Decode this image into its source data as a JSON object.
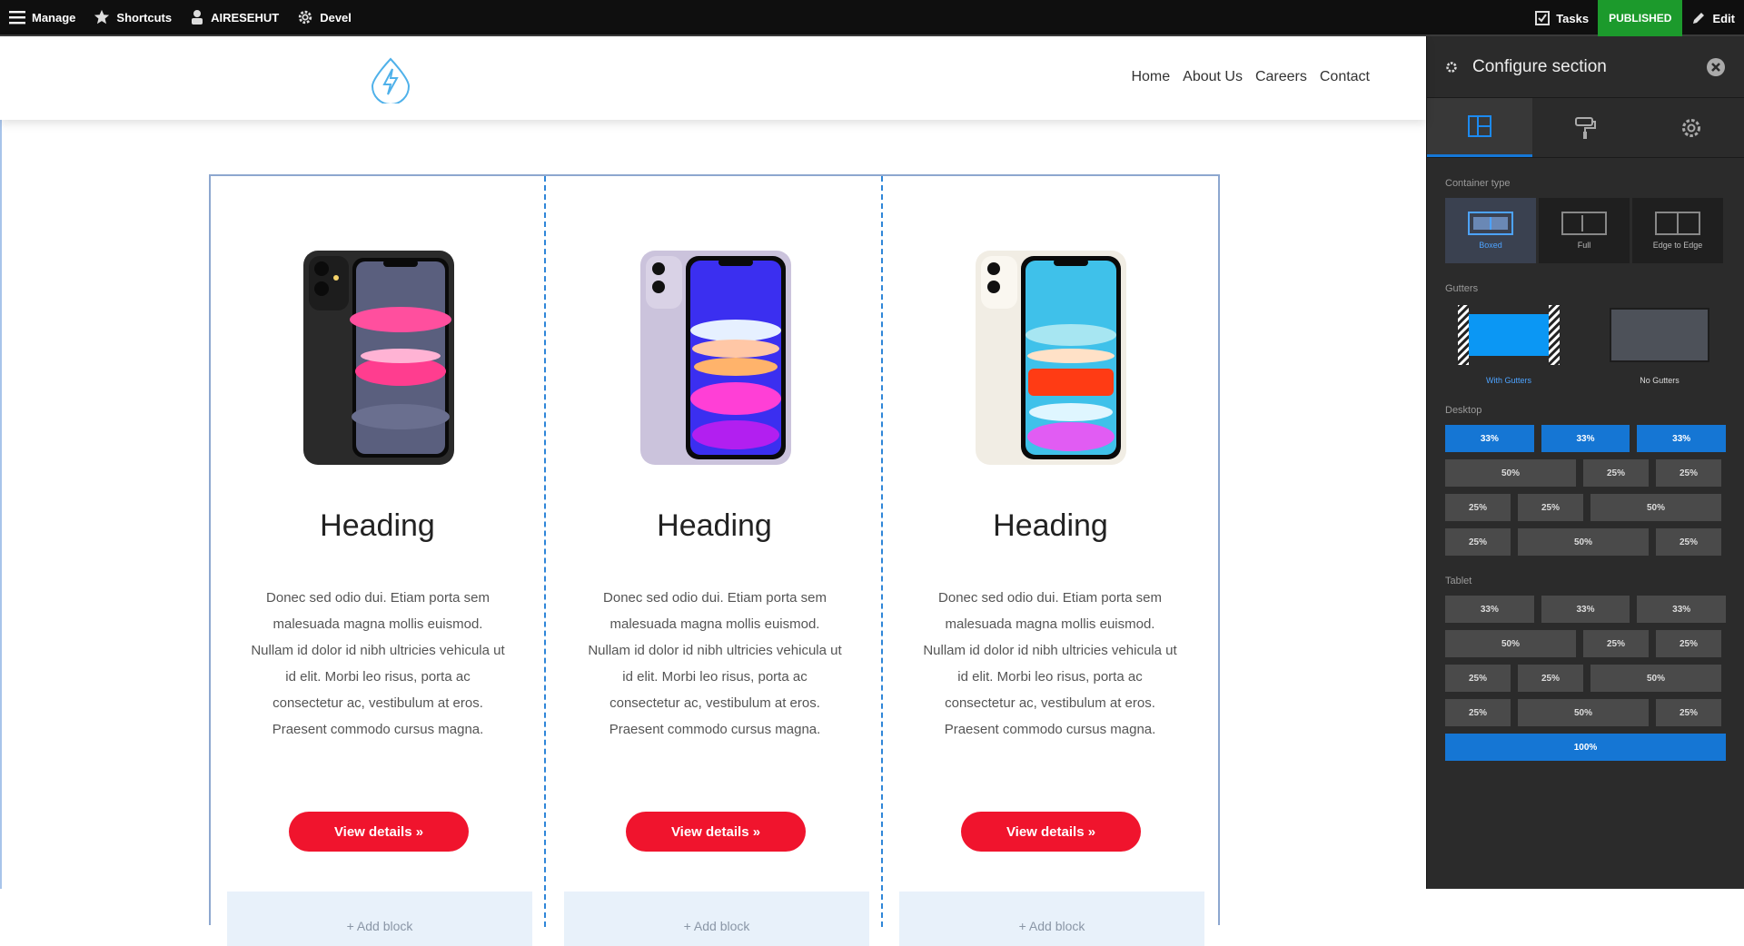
{
  "toolbar": {
    "manage": "Manage",
    "shortcuts": "Shortcuts",
    "user": "AIRESEHUT",
    "devel": "Devel",
    "tasks": "Tasks",
    "status": "PUBLISHED",
    "edit": "Edit"
  },
  "site": {
    "nav": [
      "Home",
      "About Us",
      "Careers",
      "Contact"
    ]
  },
  "cards": [
    {
      "heading": "Heading",
      "text": "Donec sed odio dui. Etiam porta sem malesuada magna mollis euismod. Nullam id dolor id nibh ultricies vehicula ut id elit. Morbi leo risus, porta ac consectetur ac, vestibulum at eros. Praesent commodo cursus magna.",
      "button": "View details »",
      "add_block": "+ Add block",
      "phone_color": "#2a2a2a"
    },
    {
      "heading": "Heading",
      "text": "Donec sed odio dui. Etiam porta sem malesuada magna mollis euismod. Nullam id dolor id nibh ultricies vehicula ut id elit. Morbi leo risus, porta ac consectetur ac, vestibulum at eros. Praesent commodo cursus magna.",
      "button": "View details »",
      "add_block": "+ Add block",
      "phone_color": "#cbc3dc"
    },
    {
      "heading": "Heading",
      "text": "Donec sed odio dui. Etiam porta sem malesuada magna mollis euismod. Nullam id dolor id nibh ultricies vehicula ut id elit. Morbi leo risus, porta ac consectetur ac, vestibulum at eros. Praesent commodo cursus magna.",
      "button": "View details »",
      "add_block": "+ Add block",
      "phone_color": "#f1ede4"
    }
  ],
  "panel": {
    "title": "Configure section",
    "container_type_label": "Container type",
    "container_types": [
      "Boxed",
      "Full",
      "Edge to Edge"
    ],
    "gutters_label": "Gutters",
    "gutters": [
      "With Gutters",
      "No Gutters"
    ],
    "desktop_label": "Desktop",
    "tablet_label": "Tablet",
    "desktop_rows": [
      [
        "33%",
        "33%",
        "33%"
      ],
      [
        "50%",
        "25%",
        "25%"
      ],
      [
        "25%",
        "25%",
        "50%"
      ],
      [
        "25%",
        "50%",
        "25%"
      ]
    ],
    "tablet_rows": [
      [
        "33%",
        "33%",
        "33%"
      ],
      [
        "50%",
        "25%",
        "25%"
      ],
      [
        "25%",
        "25%",
        "50%"
      ],
      [
        "25%",
        "50%",
        "25%"
      ]
    ],
    "tablet_full": "100%"
  },
  "colors": {
    "accent": "#1576d4",
    "button_red": "#f0142d",
    "published_green": "#1c9a2c"
  }
}
